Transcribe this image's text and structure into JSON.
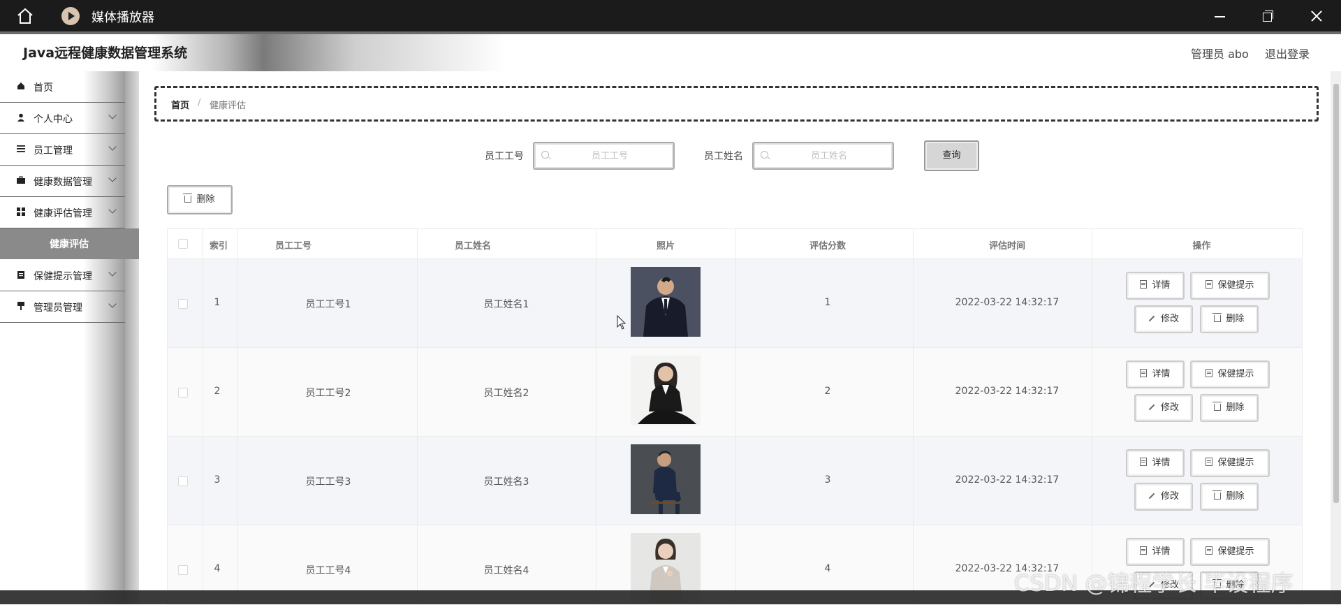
{
  "window": {
    "title": "媒体播放器"
  },
  "app": {
    "title": "Java远程健康数据管理系统",
    "admin": "管理员 abo",
    "logout": "退出登录"
  },
  "sidebar": {
    "items": [
      {
        "label": "首页",
        "icon": "home-icon"
      },
      {
        "label": "个人中心",
        "icon": "user-icon"
      },
      {
        "label": "员工管理",
        "icon": "list-icon"
      },
      {
        "label": "健康数据管理",
        "icon": "briefcase-icon"
      },
      {
        "label": "健康评估管理",
        "icon": "grid-icon"
      },
      {
        "label": "保健提示管理",
        "icon": "clipboard-icon"
      },
      {
        "label": "管理员管理",
        "icon": "flag-icon"
      }
    ],
    "active_sub": "健康评估"
  },
  "breadcrumb": {
    "home": "首页",
    "separator": "/",
    "current": "健康评估"
  },
  "search": {
    "id_label": "员工工号",
    "id_placeholder": "员工工号",
    "name_label": "员工姓名",
    "name_placeholder": "员工姓名",
    "query_button": "查询"
  },
  "toolbar": {
    "delete_label": "删除"
  },
  "table": {
    "headers": [
      "索引",
      "员工工号",
      "员工姓名",
      "照片",
      "评估分数",
      "评估时间",
      "操作"
    ],
    "rows": [
      {
        "index": "1",
        "id": "员工工号1",
        "name": "员工姓名1",
        "score": "1",
        "time": "2022-03-22 14:32:17"
      },
      {
        "index": "2",
        "id": "员工工号2",
        "name": "员工姓名2",
        "score": "2",
        "time": "2022-03-22 14:32:17"
      },
      {
        "index": "3",
        "id": "员工工号3",
        "name": "员工姓名3",
        "score": "3",
        "time": "2022-03-22 14:32:17"
      },
      {
        "index": "4",
        "id": "员工工号4",
        "name": "员工姓名4",
        "score": "4",
        "time": "2022-03-22 14:32:17"
      }
    ],
    "actions": {
      "detail": "详情",
      "tip": "保健提示",
      "edit": "修改",
      "delete": "删除"
    }
  },
  "watermark": "CSDN @锦程学长 毕设程序"
}
